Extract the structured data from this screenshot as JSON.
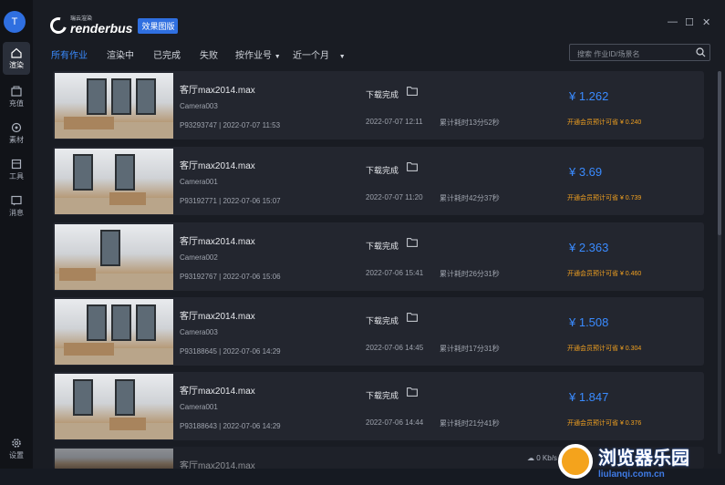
{
  "sidebar": {
    "avatar_letter": "T",
    "items": [
      {
        "label": "渲染",
        "icon": "home-icon"
      },
      {
        "label": "充值",
        "icon": "wallet-icon"
      },
      {
        "label": "素材",
        "icon": "material-icon"
      },
      {
        "label": "工具",
        "icon": "toolbox-icon"
      },
      {
        "label": "消息",
        "icon": "message-icon"
      },
      {
        "label": "设置",
        "icon": "gear-icon"
      }
    ]
  },
  "header": {
    "brand_sub": "瑞云渲染",
    "brand_name": "renderbus",
    "brand_badge": "效果图版",
    "minimize": "—",
    "maximize": "☐",
    "close": "✕"
  },
  "filters": {
    "tabs": [
      "所有作业",
      "渲染中",
      "已完成",
      "失败"
    ],
    "sort_label": "按作业号",
    "range_label": "近一个月",
    "search_placeholder": "搜索 作业ID/场景名"
  },
  "jobs": [
    {
      "file": "客厅max2014.max",
      "camera": "Camera003",
      "meta": "P93293747 | 2022-07-07 11:53",
      "status": "下载完成",
      "finish": "2022-07-07 12:11",
      "elapsed": "累计耗时13分52秒",
      "price": "¥ 1.262",
      "save": "开通会员预计可省 ¥ 0.240"
    },
    {
      "file": "客厅max2014.max",
      "camera": "Camera001",
      "meta": "P93192771 | 2022-07-06 15:07",
      "status": "下载完成",
      "finish": "2022-07-07 11:20",
      "elapsed": "累计耗时42分37秒",
      "price": "¥ 3.69",
      "save": "开通会员预计可省 ¥ 0.739"
    },
    {
      "file": "客厅max2014.max",
      "camera": "Camera002",
      "meta": "P93192767 | 2022-07-06 15:06",
      "status": "下载完成",
      "finish": "2022-07-06 15:41",
      "elapsed": "累计耗时26分31秒",
      "price": "¥ 2.363",
      "save": "开通会员预计可省 ¥ 0.460"
    },
    {
      "file": "客厅max2014.max",
      "camera": "Camera003",
      "meta": "P93188645 | 2022-07-06 14:29",
      "status": "下载完成",
      "finish": "2022-07-06 14:45",
      "elapsed": "累计耗时17分31秒",
      "price": "¥ 1.508",
      "save": "开通会员预计可省 ¥ 0.304"
    },
    {
      "file": "客厅max2014.max",
      "camera": "Camera001",
      "meta": "P93188643 | 2022-07-06 14:29",
      "status": "下载完成",
      "finish": "2022-07-06 14:44",
      "elapsed": "累计耗时21分41秒",
      "price": "¥ 1.847",
      "save": "开通会员预计可省 ¥ 0.376"
    },
    {
      "file": "客厅max2014.max",
      "camera": "",
      "meta": "",
      "status": "",
      "finish": "",
      "elapsed": "",
      "price": "",
      "save": ""
    }
  ],
  "statusbar": {
    "upload": "0 Kb/s"
  },
  "watermark": {
    "cn": "浏览器乐园",
    "url": "liulanqi.com.cn"
  },
  "colors": {
    "accent": "#3a8bff",
    "save": "#f0a020"
  }
}
